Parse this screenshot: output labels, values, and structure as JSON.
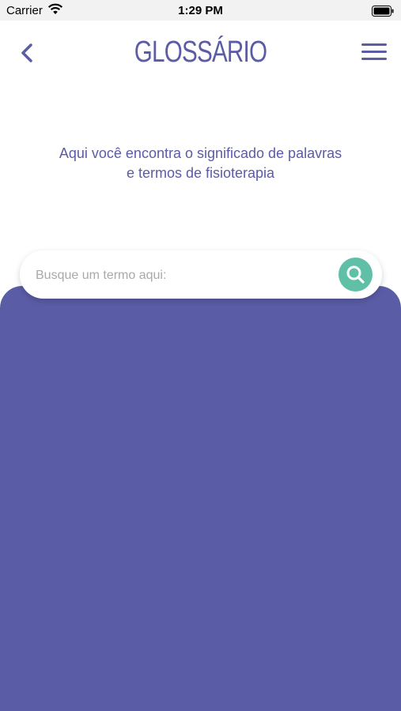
{
  "status_bar": {
    "carrier": "Carrier",
    "time": "1:29 PM",
    "wifi_icon": "wifi-icon",
    "battery_icon": "battery-icon"
  },
  "header": {
    "title": "GLOSSÁRIO",
    "back_icon": "chevron-left-icon",
    "menu_icon": "hamburger-menu-icon"
  },
  "intro": {
    "line1": "Aqui você encontra o significado de palavras",
    "line2": "e termos de fisioterapia"
  },
  "search": {
    "placeholder": "Busque um termo aqui:",
    "button_icon": "search-icon"
  },
  "colors": {
    "primary": "#5b5ca6",
    "accent": "#5fbfa7",
    "background": "#ffffff"
  }
}
